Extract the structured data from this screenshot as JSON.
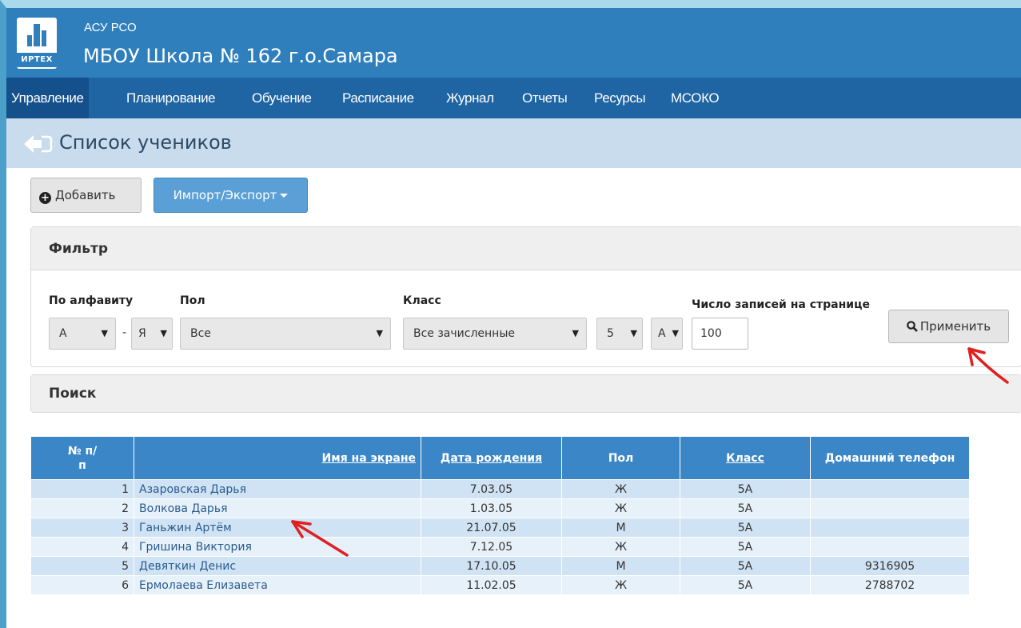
{
  "header": {
    "app_name": "АСУ РСО",
    "school": "МБОУ Школа № 162 г.о.Самара",
    "logo_text": "ИРТЕХ"
  },
  "nav": {
    "items": [
      {
        "label": "Управление"
      },
      {
        "label": "Планирование"
      },
      {
        "label": "Обучение"
      },
      {
        "label": "Расписание"
      },
      {
        "label": "Журнал"
      },
      {
        "label": "Отчеты"
      },
      {
        "label": "Ресурсы"
      },
      {
        "label": "МСОКО"
      }
    ],
    "active_index": 0
  },
  "page": {
    "title": "Список учеников"
  },
  "toolbar": {
    "add_label": "Добавить",
    "import_label": "Импорт/Экспорт"
  },
  "filter": {
    "heading": "Фильтр",
    "alpha_label": "По алфавиту",
    "alpha_from": "А",
    "alpha_to": "Я",
    "gender_label": "Пол",
    "gender_value": "Все",
    "class_label": "Класс",
    "class_value": "Все зачисленные",
    "grade_value": "5",
    "letter_value": "А",
    "page_size_label": "Число записей на странице",
    "page_size_value": "100",
    "apply_label": "Применить"
  },
  "search": {
    "heading": "Поиск"
  },
  "table": {
    "headers": {
      "num": "№ п/п",
      "name": "Имя на экране",
      "birth": "Дата рождения",
      "gender": "Пол",
      "class": "Класс",
      "phone": "Домашний телефон"
    },
    "rows": [
      {
        "num": "1",
        "name": "Азаровская Дарья",
        "birth": "7.03.05",
        "gender": "Ж",
        "class": "5А",
        "phone": ""
      },
      {
        "num": "2",
        "name": "Волкова Дарья",
        "birth": "1.03.05",
        "gender": "Ж",
        "class": "5А",
        "phone": ""
      },
      {
        "num": "3",
        "name": "Ганьжин Артём",
        "birth": "21.07.05",
        "gender": "М",
        "class": "5А",
        "phone": ""
      },
      {
        "num": "4",
        "name": "Гришина Виктория",
        "birth": "7.12.05",
        "gender": "Ж",
        "class": "5А",
        "phone": ""
      },
      {
        "num": "5",
        "name": "Девяткин Денис",
        "birth": "17.10.05",
        "gender": "М",
        "class": "5А",
        "phone": "9316905"
      },
      {
        "num": "6",
        "name": "Ермолаева Елизавета",
        "birth": "11.02.05",
        "gender": "Ж",
        "class": "5А",
        "phone": "2788702"
      }
    ]
  },
  "colors": {
    "header_bg": "#2f7fbd",
    "nav_bg": "#1f64a3",
    "annotation_arrow": "#e02020"
  }
}
